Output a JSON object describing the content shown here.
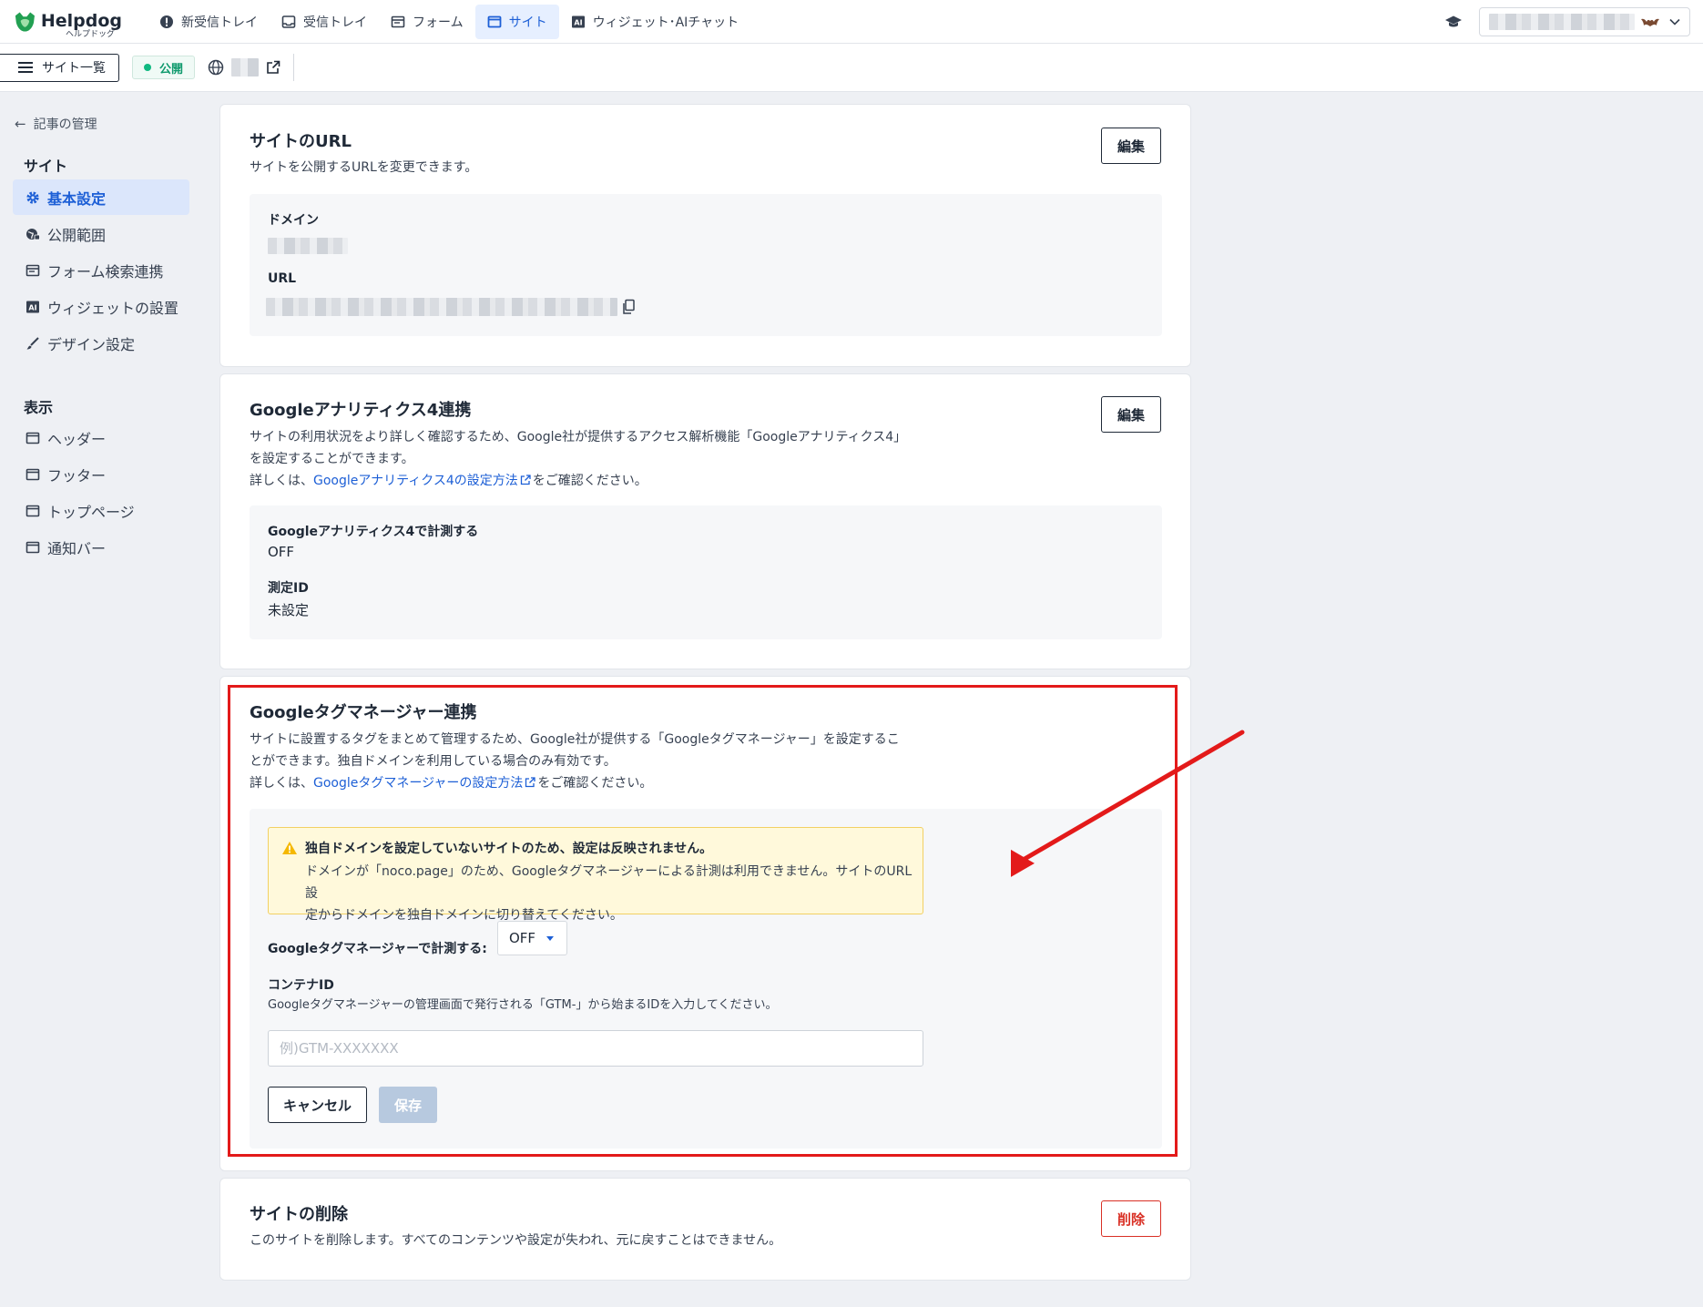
{
  "topbar": {
    "logo_text": "Helpdog",
    "logo_sub": "ヘルプドッグ",
    "nav": [
      {
        "label": "新受信トレイ",
        "icon": "alert-circle-icon"
      },
      {
        "label": "受信トレイ",
        "icon": "inbox-icon"
      },
      {
        "label": "フォーム",
        "icon": "form-icon"
      },
      {
        "label": "サイト",
        "icon": "site-icon",
        "active": true
      },
      {
        "label": "ウィジェット･AIチャット",
        "icon": "ai-icon"
      }
    ]
  },
  "subbar": {
    "site_list_label": "サイト一覧",
    "status_label": "公開"
  },
  "sidebar": {
    "back_label": "記事の管理",
    "section_site": "サイト",
    "site_items": [
      {
        "label": "基本設定",
        "icon": "gear-icon",
        "active": true
      },
      {
        "label": "公開範囲",
        "icon": "globe-lock-icon"
      },
      {
        "label": "フォーム検索連携",
        "icon": "form-search-icon"
      },
      {
        "label": "ウィジェットの設置",
        "icon": "ai-icon"
      },
      {
        "label": "デザイン設定",
        "icon": "brush-icon"
      }
    ],
    "section_display": "表示",
    "display_items": [
      {
        "label": "ヘッダー",
        "icon": "window-icon"
      },
      {
        "label": "フッター",
        "icon": "window-icon"
      },
      {
        "label": "トップページ",
        "icon": "window-icon"
      },
      {
        "label": "通知バー",
        "icon": "window-icon"
      }
    ]
  },
  "url_card": {
    "title": "サイトのURL",
    "desc": "サイトを公開するURLを変更できます。",
    "edit_label": "編集",
    "domain_label": "ドメイン",
    "url_label": "URL"
  },
  "ga4_card": {
    "title": "Googleアナリティクス4連携",
    "desc_line1": "サイトの利用状況をより詳しく確認するため、Google社が提供するアクセス解析機能「Googleアナリティクス4」",
    "desc_line2": "を設定することができます。",
    "desc_prefix": "詳しくは、",
    "desc_link": "Googleアナリティクス4の設定方法",
    "desc_suffix": "をご確認ください。",
    "edit_label": "編集",
    "measure_label": "Googleアナリティクス4で計測する",
    "measure_value": "OFF",
    "id_label": "測定ID",
    "id_value": "未設定"
  },
  "gtm_card": {
    "title": "Googleタグマネージャー連携",
    "desc_line1": "サイトに設置するタグをまとめて管理するため、Google社が提供する「Googleタグマネージャー」を設定するこ",
    "desc_line2": "とができます。独自ドメインを利用している場合のみ有効です。",
    "desc_prefix": "詳しくは、",
    "desc_link": "Googleタグマネージャーの設定方法",
    "desc_suffix": "をご確認ください。",
    "warning_title": "独自ドメインを設定していないサイトのため、設定は反映されません。",
    "warning_line1": "ドメインが「noco.page」のため、Googleタグマネージャーによる計測は利用できません。サイトのURL設",
    "warning_line2": "定からドメインを独自ドメインに切り替えてください。",
    "measure_label": "Googleタグマネージャーで計測する:",
    "measure_value": "OFF",
    "container_label": "コンテナID",
    "container_help": "Googleタグマネージャーの管理画面で発行される「GTM-」から始まるIDを入力してください。",
    "container_placeholder": "例)GTM-XXXXXXX",
    "container_value": "",
    "cancel_label": "キャンセル",
    "save_label": "保存"
  },
  "delete_card": {
    "title": "サイトの削除",
    "desc": "このサイトを削除します。すべてのコンテンツや設定が失われ、元に戻すことはできません。",
    "delete_label": "削除"
  },
  "colors": {
    "accent": "#1d5fd6",
    "highlight": "#e31a1a",
    "published": "#10b981",
    "danger": "#d93025",
    "warning_bg": "#fff9db"
  }
}
